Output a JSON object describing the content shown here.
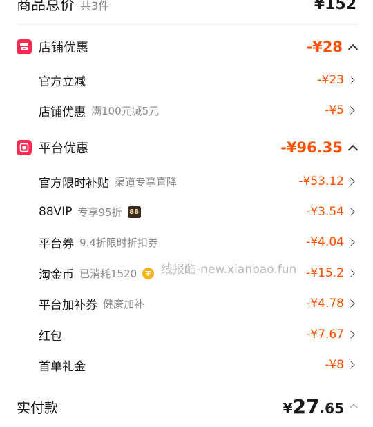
{
  "summary": {
    "title": "商品总价",
    "count": "共3件",
    "value": "¥152"
  },
  "shop_discount": {
    "label": "店铺优惠",
    "value": "-¥28",
    "icon": "shop-icon",
    "items": [
      {
        "label": "官方立减",
        "sub": "",
        "value": "-¥23"
      },
      {
        "label": "店铺优惠",
        "sub": "满100元减5元",
        "value": "-¥5"
      }
    ]
  },
  "platform_discount": {
    "label": "平台优惠",
    "value": "-¥96.35",
    "icon": "platform-icon",
    "items": [
      {
        "label": "官方限时补贴",
        "sub": "渠道专享直降",
        "value": "-¥53.12"
      },
      {
        "label": "88VIP",
        "sub": "专享95折",
        "badge": "88",
        "value": "-¥3.54"
      },
      {
        "label": "平台券",
        "sub": "9.4折限时折扣券",
        "value": "-¥4.04"
      },
      {
        "label": "淘金币",
        "sub": "已消耗1520",
        "value": "-¥15.2"
      },
      {
        "label": "平台加补券",
        "sub": "健康加补",
        "value": "-¥4.78"
      },
      {
        "label": "红包",
        "sub": "",
        "value": "-¥7.67"
      },
      {
        "label": "首单礼金",
        "sub": "",
        "value": "-¥8"
      }
    ]
  },
  "watermark": "线报酷-new.xianbao.fun",
  "total": {
    "label": "实付款",
    "currency": "¥",
    "integer": "27",
    "decimal": ".65"
  },
  "colors": {
    "accent": "#ff5000",
    "badge": "#ff2a52"
  }
}
